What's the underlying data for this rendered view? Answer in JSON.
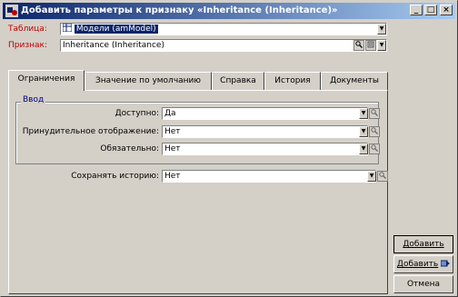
{
  "window": {
    "title": "Добавить параметры к признаку «Inheritance (Inheritance)»",
    "controls": {
      "minimize": "_",
      "maximize": "□",
      "close": "×"
    }
  },
  "header": {
    "table_label": "Таблица:",
    "table_value": "Модели (amModel)",
    "feature_label": "Признак:",
    "feature_value": "Inheritance (Inheritance)"
  },
  "tabs": [
    {
      "label": "Ограничения",
      "active": true
    },
    {
      "label": "Значение по умолчанию",
      "active": false
    },
    {
      "label": "Справка",
      "active": false
    },
    {
      "label": "История",
      "active": false
    },
    {
      "label": "Документы",
      "active": false
    }
  ],
  "group": {
    "title": "Ввод",
    "fields": [
      {
        "label": "Доступно:",
        "value": "Да"
      },
      {
        "label": "Принудительное отображение:",
        "value": "Нет"
      },
      {
        "label": "Обязательно:",
        "value": "Нет"
      }
    ]
  },
  "history": {
    "label": "Сохранять историю:",
    "value": "Нет"
  },
  "buttons": {
    "add": "Добавить",
    "add_more": "Добавить",
    "cancel": "Отмена"
  },
  "icons": {
    "dropdown": "▼",
    "zoom": "magnifier-icon"
  }
}
